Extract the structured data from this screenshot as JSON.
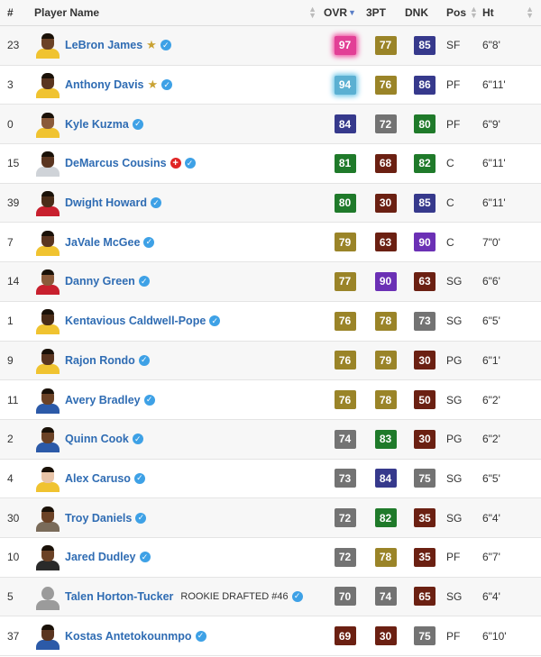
{
  "header": {
    "num": "#",
    "player_name": "Player Name",
    "ovr": "OVR",
    "three_pt": "3PT",
    "dnk": "DNK",
    "pos": "Pos",
    "ht": "Ht"
  },
  "colors": {
    "pink": "#e23f96",
    "light_blue": "#5bb0d2",
    "navy": "#36398c",
    "dark_green": "#1f7a2a",
    "gold": "#9a8428",
    "dark_red": "#6b2012",
    "gray": "#737373",
    "purple": "#6b30b5",
    "link_blue": "#2f6cb3",
    "verified_blue": "#3ea1e6",
    "star_gold": "#c9a233",
    "injury_red": "#e02424"
  },
  "players": [
    {
      "num": "23",
      "name": "LeBron James",
      "star": true,
      "injury": false,
      "rookie": "",
      "ovr": "97",
      "ovr_color": "pink",
      "ovr_glow": "pink",
      "three": "77",
      "three_color": "gold",
      "dnk": "85",
      "dnk_color": "navy",
      "pos": "SF",
      "ht": "6\"8'",
      "skin": "#6b4226",
      "jersey": "#f0c330",
      "icon": "player-headshot-icon"
    },
    {
      "num": "3",
      "name": "Anthony Davis",
      "star": true,
      "injury": false,
      "rookie": "",
      "ovr": "94",
      "ovr_color": "light_blue",
      "ovr_glow": "blue",
      "three": "76",
      "three_color": "gold",
      "dnk": "86",
      "dnk_color": "navy",
      "pos": "PF",
      "ht": "6\"11'",
      "skin": "#5a3520",
      "jersey": "#f0c330",
      "icon": "player-headshot-icon"
    },
    {
      "num": "0",
      "name": "Kyle Kuzma",
      "star": false,
      "injury": false,
      "rookie": "",
      "ovr": "84",
      "ovr_color": "navy",
      "ovr_glow": "",
      "three": "72",
      "three_color": "gray",
      "dnk": "80",
      "dnk_color": "dark_green",
      "pos": "PF",
      "ht": "6\"9'",
      "skin": "#8a5a3a",
      "jersey": "#f0c330",
      "icon": "player-headshot-icon"
    },
    {
      "num": "15",
      "name": "DeMarcus Cousins",
      "star": false,
      "injury": true,
      "rookie": "",
      "ovr": "81",
      "ovr_color": "dark_green",
      "ovr_glow": "",
      "three": "68",
      "three_color": "dark_red",
      "dnk": "82",
      "dnk_color": "dark_green",
      "pos": "C",
      "ht": "6\"11'",
      "skin": "#5a3520",
      "jersey": "#cfd3d8",
      "icon": "player-headshot-icon"
    },
    {
      "num": "39",
      "name": "Dwight Howard",
      "star": false,
      "injury": false,
      "rookie": "",
      "ovr": "80",
      "ovr_color": "dark_green",
      "ovr_glow": "",
      "three": "30",
      "three_color": "dark_red",
      "dnk": "85",
      "dnk_color": "navy",
      "pos": "C",
      "ht": "6\"11'",
      "skin": "#4a2c18",
      "jersey": "#c8202e",
      "icon": "player-headshot-icon"
    },
    {
      "num": "7",
      "name": "JaVale McGee",
      "star": false,
      "injury": false,
      "rookie": "",
      "ovr": "79",
      "ovr_color": "gold",
      "ovr_glow": "",
      "three": "63",
      "three_color": "dark_red",
      "dnk": "90",
      "dnk_color": "purple",
      "pos": "C",
      "ht": "7\"0'",
      "skin": "#5a3520",
      "jersey": "#f0c330",
      "icon": "player-headshot-icon"
    },
    {
      "num": "14",
      "name": "Danny Green",
      "star": false,
      "injury": false,
      "rookie": "",
      "ovr": "77",
      "ovr_color": "gold",
      "ovr_glow": "",
      "three": "90",
      "three_color": "purple",
      "dnk": "63",
      "dnk_color": "dark_red",
      "pos": "SG",
      "ht": "6\"6'",
      "skin": "#8a5a3a",
      "jersey": "#c8202e",
      "icon": "player-headshot-icon"
    },
    {
      "num": "1",
      "name": "Kentavious Caldwell-Pope",
      "star": false,
      "injury": false,
      "rookie": "",
      "ovr": "76",
      "ovr_color": "gold",
      "ovr_glow": "",
      "three": "78",
      "three_color": "gold",
      "dnk": "73",
      "dnk_color": "gray",
      "pos": "SG",
      "ht": "6\"5'",
      "skin": "#4a2c18",
      "jersey": "#f0c330",
      "icon": "player-headshot-icon"
    },
    {
      "num": "9",
      "name": "Rajon Rondo",
      "star": false,
      "injury": false,
      "rookie": "",
      "ovr": "76",
      "ovr_color": "gold",
      "ovr_glow": "",
      "three": "79",
      "three_color": "gold",
      "dnk": "30",
      "dnk_color": "dark_red",
      "pos": "PG",
      "ht": "6\"1'",
      "skin": "#5a3520",
      "jersey": "#f0c330",
      "icon": "player-headshot-icon"
    },
    {
      "num": "11",
      "name": "Avery Bradley",
      "star": false,
      "injury": false,
      "rookie": "",
      "ovr": "76",
      "ovr_color": "gold",
      "ovr_glow": "",
      "three": "78",
      "three_color": "gold",
      "dnk": "50",
      "dnk_color": "dark_red",
      "pos": "SG",
      "ht": "6\"2'",
      "skin": "#6b4226",
      "jersey": "#2c5aa8",
      "icon": "player-headshot-icon"
    },
    {
      "num": "2",
      "name": "Quinn Cook",
      "star": false,
      "injury": false,
      "rookie": "",
      "ovr": "74",
      "ovr_color": "gray",
      "ovr_glow": "",
      "three": "83",
      "three_color": "dark_green",
      "dnk": "30",
      "dnk_color": "dark_red",
      "pos": "PG",
      "ht": "6\"2'",
      "skin": "#6b4226",
      "jersey": "#2c5aa8",
      "icon": "player-headshot-icon"
    },
    {
      "num": "4",
      "name": "Alex Caruso",
      "star": false,
      "injury": false,
      "rookie": "",
      "ovr": "73",
      "ovr_color": "gray",
      "ovr_glow": "",
      "three": "84",
      "three_color": "navy",
      "dnk": "75",
      "dnk_color": "gray",
      "pos": "SG",
      "ht": "6\"5'",
      "skin": "#e8c4a8",
      "jersey": "#f0c330",
      "icon": "player-headshot-icon"
    },
    {
      "num": "30",
      "name": "Troy Daniels",
      "star": false,
      "injury": false,
      "rookie": "",
      "ovr": "72",
      "ovr_color": "gray",
      "ovr_glow": "",
      "three": "82",
      "three_color": "dark_green",
      "dnk": "35",
      "dnk_color": "dark_red",
      "pos": "SG",
      "ht": "6\"4'",
      "skin": "#6b4226",
      "jersey": "#7a6b5a",
      "icon": "player-headshot-icon"
    },
    {
      "num": "10",
      "name": "Jared Dudley",
      "star": false,
      "injury": false,
      "rookie": "",
      "ovr": "72",
      "ovr_color": "gray",
      "ovr_glow": "",
      "three": "78",
      "three_color": "gold",
      "dnk": "35",
      "dnk_color": "dark_red",
      "pos": "PF",
      "ht": "6\"7'",
      "skin": "#6b4226",
      "jersey": "#2a2a2a",
      "icon": "player-headshot-icon"
    },
    {
      "num": "5",
      "name": "Talen Horton-Tucker",
      "star": false,
      "injury": false,
      "rookie": "ROOKIE DRAFTED #46",
      "ovr": "70",
      "ovr_color": "gray",
      "ovr_glow": "",
      "three": "74",
      "three_color": "gray",
      "dnk": "65",
      "dnk_color": "dark_red",
      "pos": "SG",
      "ht": "6\"4'",
      "skin": "placeholder",
      "jersey": "#9a9a9a",
      "icon": "placeholder-avatar-icon"
    },
    {
      "num": "37",
      "name": "Kostas Antetokounmpo",
      "star": false,
      "injury": false,
      "rookie": "",
      "ovr": "69",
      "ovr_color": "dark_red",
      "ovr_glow": "",
      "three": "30",
      "three_color": "dark_red",
      "dnk": "75",
      "dnk_color": "gray",
      "pos": "PF",
      "ht": "6\"10'",
      "skin": "#5a3520",
      "jersey": "#2c5aa8",
      "icon": "player-headshot-icon"
    }
  ]
}
